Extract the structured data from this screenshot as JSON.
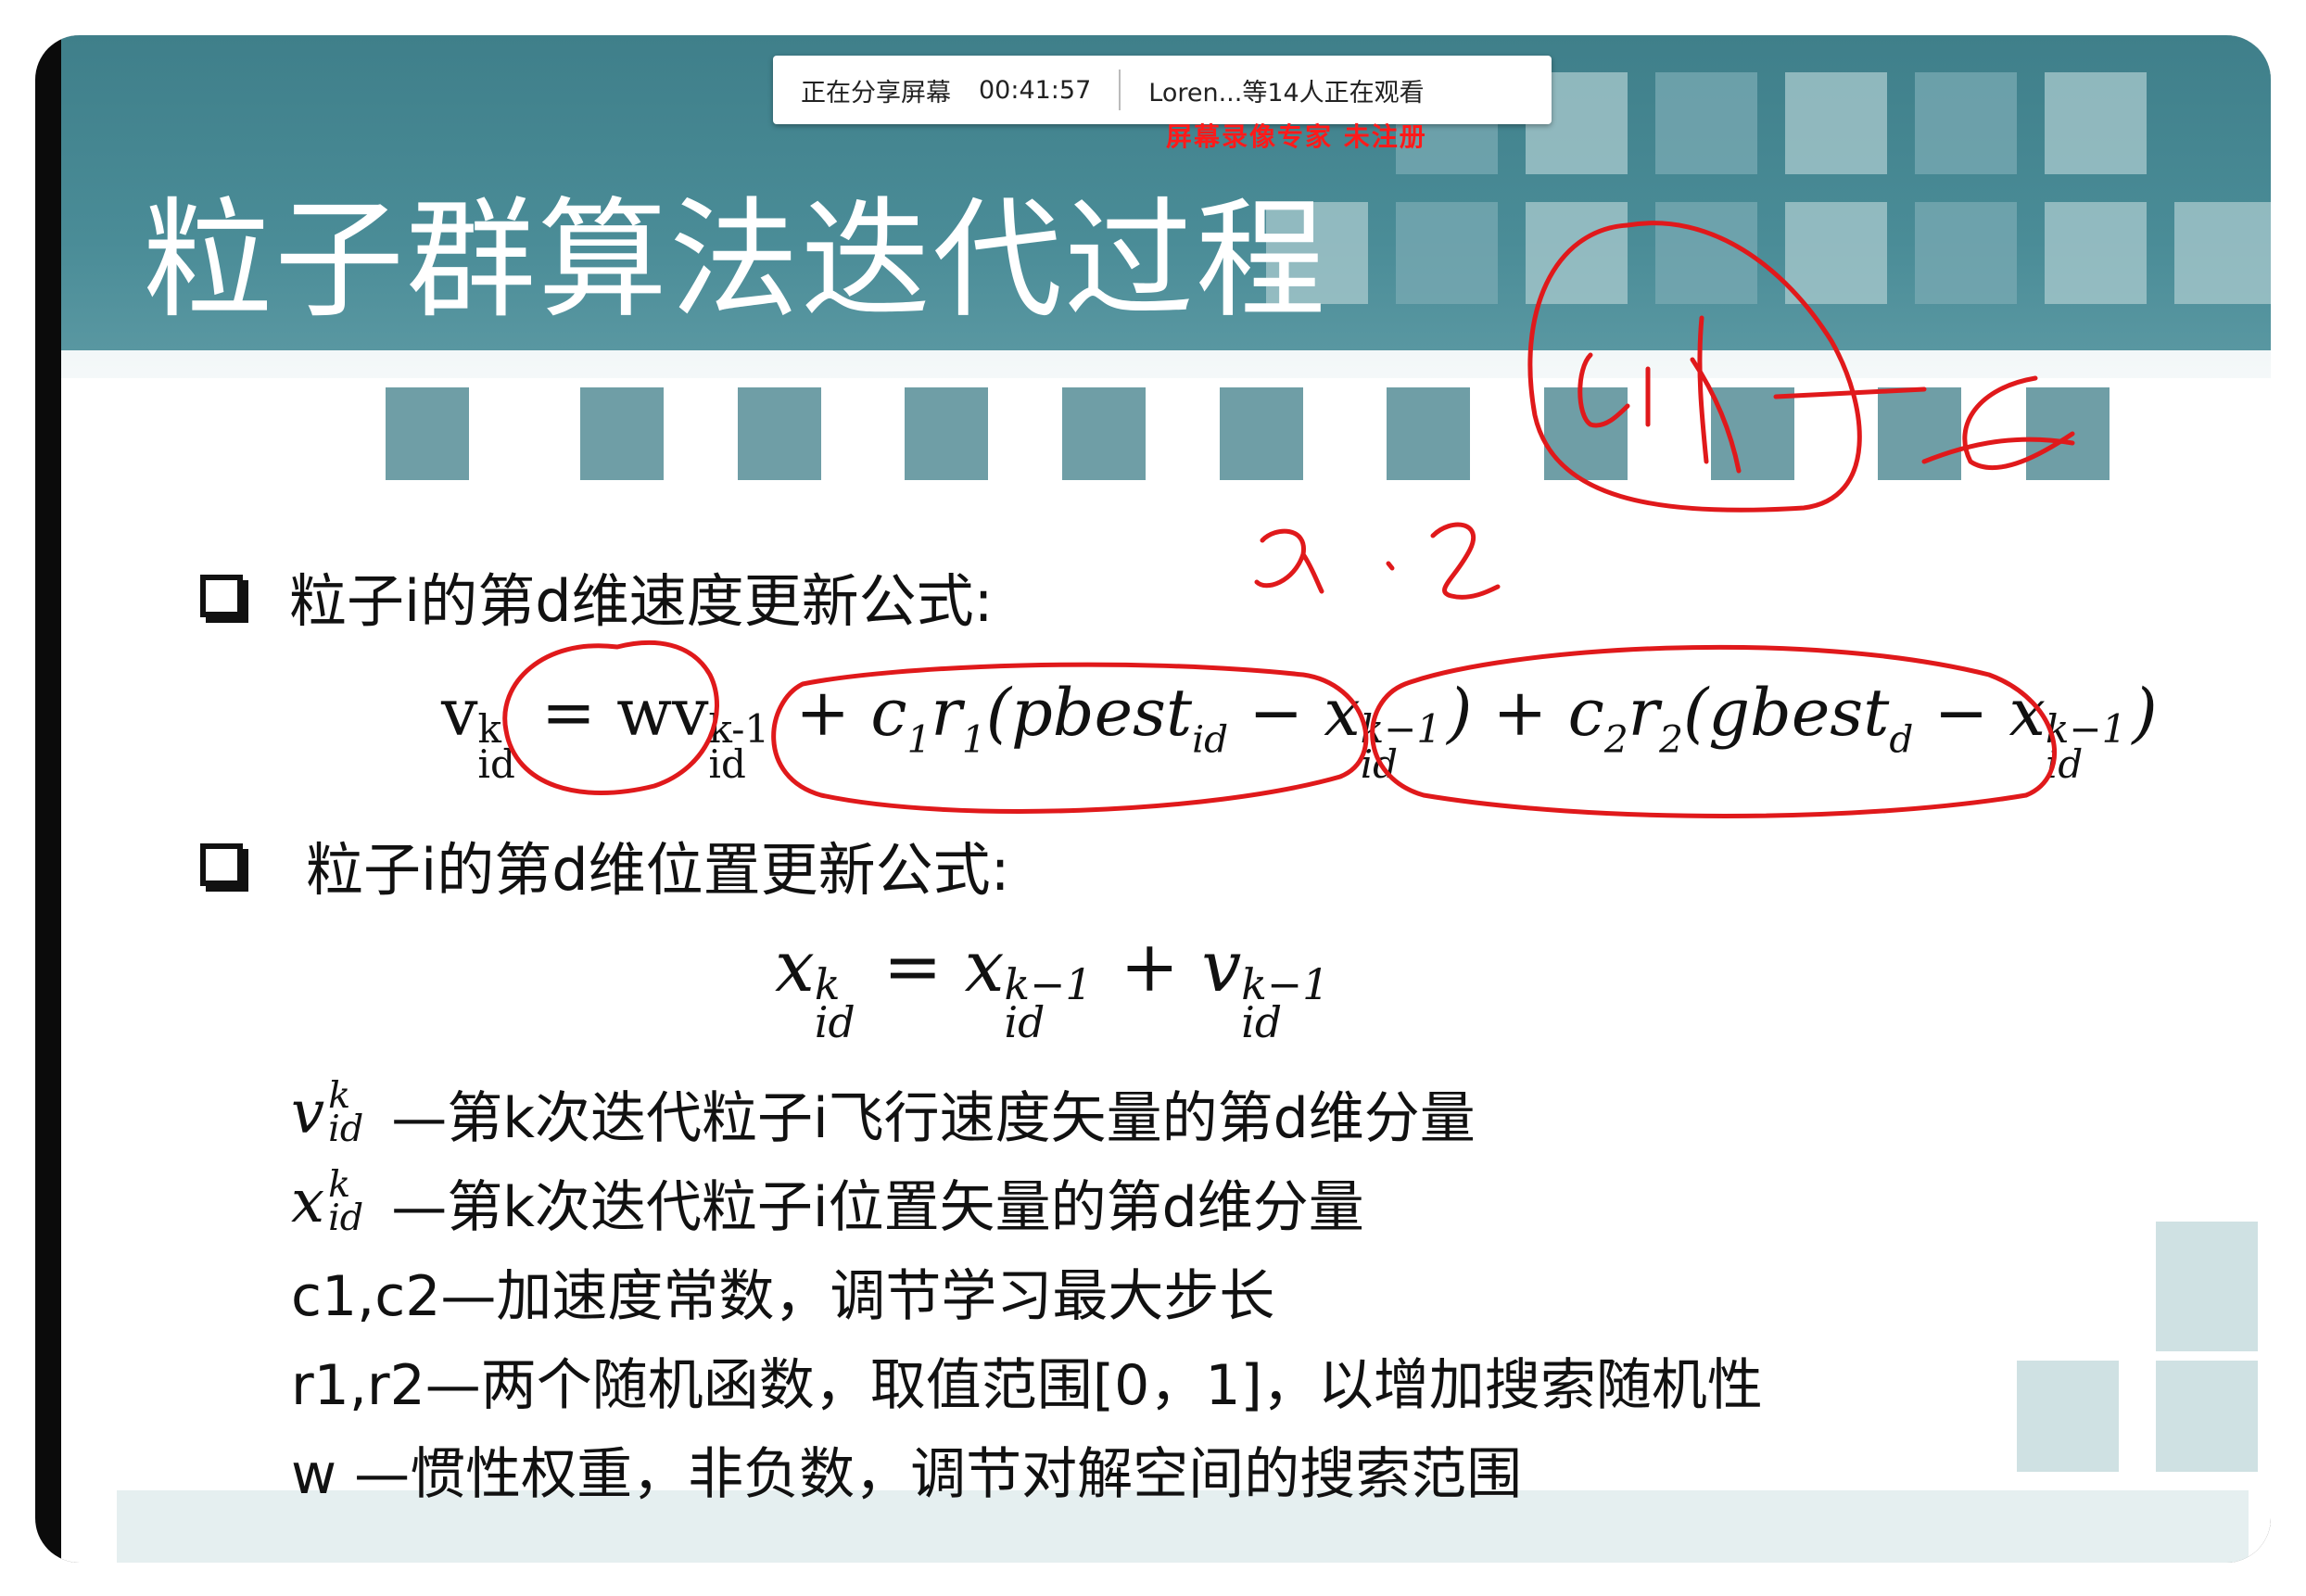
{
  "share_bar": {
    "status": "正在分享屏幕",
    "timer": "00:41:57",
    "viewers": "Loren...等14人正在观看"
  },
  "watermark": "屏幕录像专家 未注册",
  "slide": {
    "title": "粒子群算法迭代过程",
    "bullet1": "粒子i的第d维速度更新公式:",
    "bullet2": "粒子i的第d维位置更新公式:",
    "formula1": {
      "v": "v",
      "v_sup": "k",
      "v_sub": "id",
      "eq": "=",
      "w": "wv",
      "w_sup": "k-1",
      "w_sub": "id",
      "plus1": "+",
      "c1": "c",
      "c1_sub": "1",
      "r1": "r",
      "r1_sub": "1",
      "pbest": "(pbest",
      "pbest_sub": "id",
      "minus1": " − x",
      "x1_sup": "k−1",
      "x1_sub": "id",
      "close1": ")",
      "plus2": "+",
      "c2": "c",
      "c2_sub": "2",
      "r2": "r",
      "r2_sub": "2",
      "gbest": "(gbest",
      "gbest_sub": "d",
      "minus2": " − x",
      "x2_sup": "k−1",
      "x2_sub": "id",
      "close2": ")"
    },
    "formula2": {
      "x": "x",
      "x_sup": "k",
      "x_sub": "id",
      "eq": " = x",
      "x2_sup": "k−1",
      "x2_sub": "id",
      "plus": " + v",
      "v_sup": "k−1",
      "v_sub": "id"
    },
    "definitions": [
      {
        "sym": "v",
        "sup": "k",
        "sub": "id",
        "text": "—第k次迭代粒子i飞行速度矢量的第d维分量"
      },
      {
        "sym": "x",
        "sup": "k",
        "sub": "id",
        "text": "—第k次迭代粒子i位置矢量的第d维分量"
      },
      {
        "text": "c1,c2—加速度常数，调节学习最大步长"
      },
      {
        "text": "r1,r2—两个随机函数，取值范围[0，1]，以增加搜索随机性"
      },
      {
        "text": "w —惯性权重，非负数，调节对解空间的搜索范围"
      }
    ]
  },
  "annotation_color": "#e0191b"
}
